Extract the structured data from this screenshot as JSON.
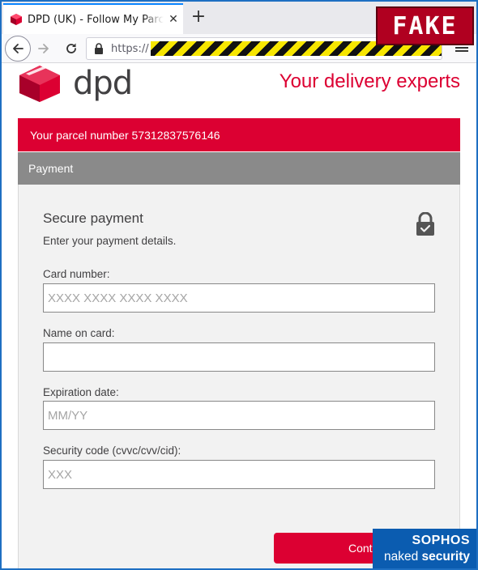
{
  "browser": {
    "tab_title": "DPD (UK) - Follow My Parcel",
    "tab_close": "✕",
    "new_tab": "+",
    "url_prefix": "https://"
  },
  "overlay": {
    "fake_label": "FAKE",
    "sophos_brand": "SOPHOS",
    "sophos_naked": "naked ",
    "sophos_security": "security"
  },
  "header": {
    "logo_text": "dpd",
    "tagline": "Your delivery experts"
  },
  "parcel": {
    "label": "Your parcel number 57312837576146"
  },
  "section": {
    "title": "Payment"
  },
  "form": {
    "title": "Secure payment",
    "subtitle": "Enter your payment details.",
    "card_number": {
      "label": "Card number:",
      "placeholder": "XXXX XXXX XXXX XXXX",
      "value": ""
    },
    "name_on_card": {
      "label": "Name on card:",
      "placeholder": "",
      "value": ""
    },
    "expiration": {
      "label": "Expiration date:",
      "placeholder": "MM/YY",
      "value": ""
    },
    "security_code": {
      "label": "Security code (cvvc/cvv/cid):",
      "placeholder": "XXX",
      "value": ""
    },
    "continue_label": "Continue"
  },
  "colors": {
    "brand_red": "#dc0032",
    "section_grey": "#8a8a8a",
    "sophos_blue": "#0b5cb0"
  },
  "icons": {
    "favicon": "dpd-cube-icon",
    "back": "arrow-left-icon",
    "forward": "arrow-right-icon",
    "reload": "reload-icon",
    "secure": "lock-icon",
    "menu": "hamburger-menu-icon"
  }
}
